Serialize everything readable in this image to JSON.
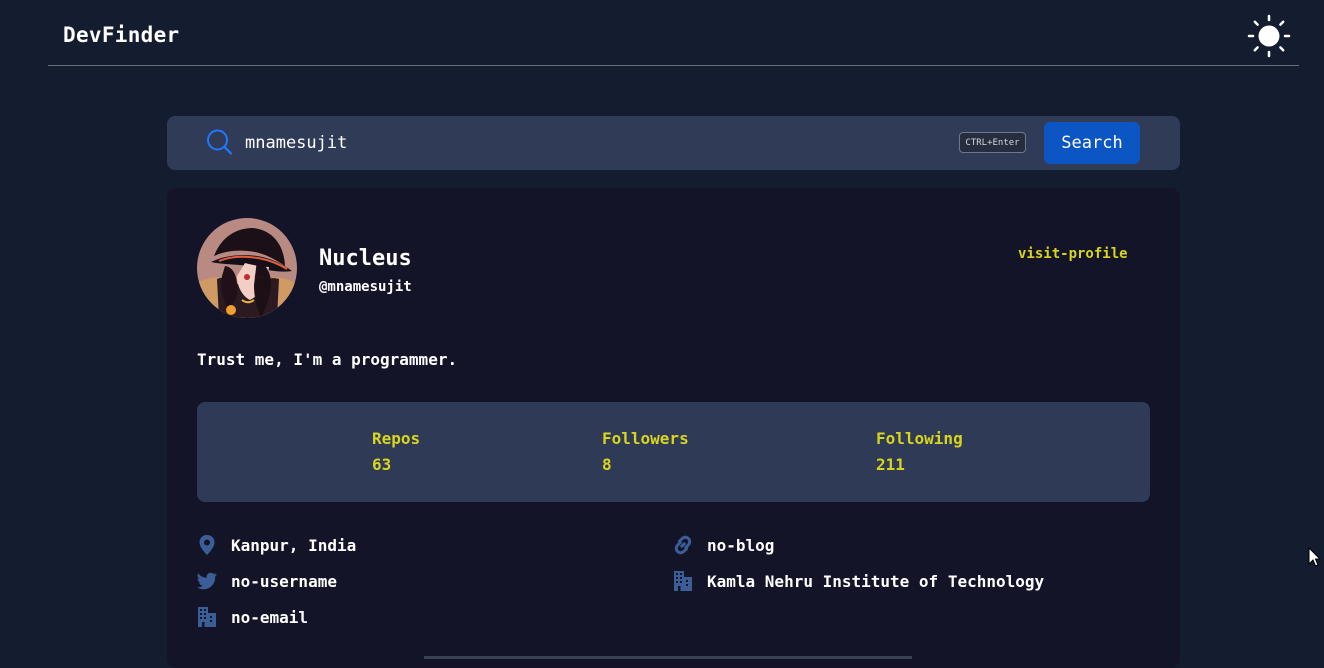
{
  "header": {
    "title": "DevFinder",
    "theme_toggle_icon": "sun-icon"
  },
  "search": {
    "icon": "search-icon",
    "value": "mnamesujit",
    "shortcut": "CTRL+Enter",
    "button_label": "Search"
  },
  "profile": {
    "avatar_icon": "avatar",
    "name": "Nucleus",
    "login": "@mnamesujit",
    "visit_link": "visit-profile",
    "bio": "Trust me, I'm a programmer.",
    "stats": [
      {
        "label": "Repos",
        "value": "63"
      },
      {
        "label": "Followers",
        "value": "8"
      },
      {
        "label": "Following",
        "value": "211"
      }
    ],
    "details": {
      "location": {
        "icon": "map-pin-icon",
        "text": "Kanpur, India"
      },
      "blog": {
        "icon": "link-icon",
        "text": "no-blog"
      },
      "twitter": {
        "icon": "twitter-icon",
        "text": "no-username"
      },
      "company": {
        "icon": "building-icon",
        "text": "Kamla Nehru Institute of Technology"
      },
      "email": {
        "icon": "building-icon",
        "text": "no-email"
      }
    }
  },
  "colors": {
    "page_bg": "#141c2f",
    "card_bg": "#131428",
    "panel_bg": "#2f3a57",
    "accent_yellow": "#d9d51c",
    "button_blue": "#0b56c2",
    "icon_blue": "#3c5e96"
  }
}
